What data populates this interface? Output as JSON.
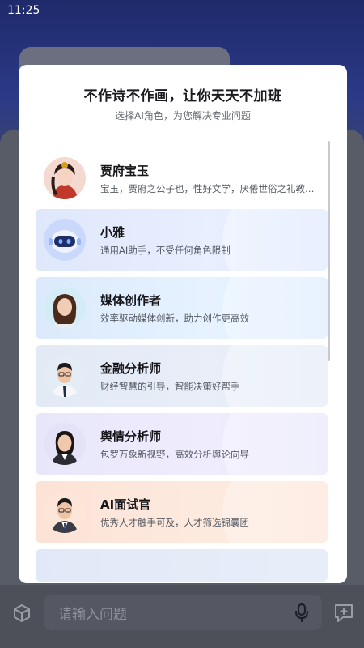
{
  "status_bar": {
    "time": "11:25"
  },
  "modal": {
    "title": "不作诗不作画，让你天天不加班",
    "subtitle": "选择AI角色，为您解决专业问题",
    "roles": [
      {
        "name": "贾府宝玉",
        "desc": "宝玉，贾府之公子也，性好文学，厌倦世俗之礼教，...",
        "avatar": "jia-baoyu-avatar"
      },
      {
        "name": "小雅",
        "desc": "通用AI助手，不受任何角色限制",
        "avatar": "robot-avatar"
      },
      {
        "name": "媒体创作者",
        "desc": "效率驱动媒体创新，助力创作更高效",
        "avatar": "media-creator-avatar"
      },
      {
        "name": "金融分析师",
        "desc": "财经智慧的引导，智能决策好帮手",
        "avatar": "financial-analyst-avatar"
      },
      {
        "name": "舆情分析师",
        "desc": "包罗万象新视野，高效分析舆论向导",
        "avatar": "public-opinion-analyst-avatar"
      },
      {
        "name": "AI面试官",
        "desc": "优秀人才触手可及，人才筛选锦囊团",
        "avatar": "ai-interviewer-avatar"
      }
    ]
  },
  "bottom_bar": {
    "input_placeholder": "请输入问题",
    "icons": [
      "cube-icon",
      "mic-icon",
      "chat-add-icon"
    ]
  }
}
